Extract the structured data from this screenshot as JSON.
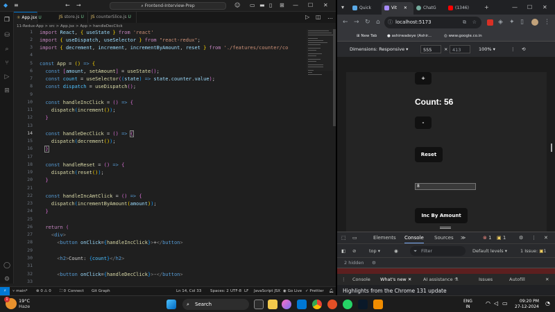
{
  "vscode": {
    "search_text": "Frontend-Interview-Prep",
    "tabs": [
      {
        "name": "App.jsx",
        "mark": "U",
        "active": false
      },
      {
        "name": "store.js",
        "mark": "U",
        "active": false
      },
      {
        "name": "counterSlice.js",
        "mark": "U",
        "active": false
      }
    ],
    "breadcrumb": [
      "11-Redux-App",
      "src",
      "App.jsx",
      "App",
      "handleDecClick"
    ],
    "line_numbers": [
      "1",
      "2",
      "3",
      "4",
      "5",
      "6",
      "7",
      "8",
      "9",
      "10",
      "11",
      "12",
      "13",
      "14",
      "15",
      "16",
      "17",
      "18",
      "19",
      "20",
      "21",
      "22",
      "23",
      "24",
      "25",
      "26",
      "27",
      "28",
      "29",
      "30",
      "31",
      "32",
      "33"
    ],
    "current_line": "14",
    "status": {
      "branch": "main*",
      "errors": "0",
      "warnings": "0",
      "ports": "0",
      "connect": "Connect",
      "git_graph": "Git Graph",
      "position": "Ln 14, Col 33",
      "spaces": "Spaces: 2",
      "encoding": "UTF-8",
      "eol": "LF",
      "language": "JavaScript JSX",
      "golive": "Go Live",
      "prettier": "Prettier"
    }
  },
  "browser": {
    "tabs": [
      {
        "title": "Quick",
        "active": false,
        "color": "#5aa9e6"
      },
      {
        "title": "Vit",
        "active": true,
        "color": "#a78bfa"
      },
      {
        "title": "ChatG",
        "active": false,
        "color": "#74aa9c"
      },
      {
        "title": "(1346)",
        "active": false,
        "color": "#ff0000"
      }
    ],
    "url": "localhost:5173",
    "bookmarks": [
      "New Tab",
      "ashirwadeye (Ashir...",
      "www.google.co.in"
    ],
    "devbar": {
      "dimensions": "Dimensions: Responsive",
      "width": "555",
      "height": "413",
      "zoom": "100%"
    },
    "page": {
      "increment_label": "+",
      "count_text": "Count: 56",
      "decrement_label": "-",
      "reset_label": "Reset",
      "amount_value": "8",
      "inc_amount_label": "Inc By Amount"
    },
    "devtools": {
      "tabs": [
        "Elements",
        "Console",
        "Sources"
      ],
      "active_tab": "Console",
      "error_count": "1",
      "warning_count": "1",
      "context": "top",
      "filter_placeholder": "Filter",
      "levels": "Default levels",
      "issues": "1 Issue:",
      "issue_count": "1",
      "hidden": "2 hidden",
      "drawer_tabs": [
        "Console",
        "What's new",
        "AI assistance",
        "Issues",
        "Autofill"
      ],
      "active_drawer_tab": "What's new",
      "highlights": "Highlights from the Chrome 131 update"
    }
  },
  "taskbar": {
    "weather_temp": "19°C",
    "weather_desc": "Haze",
    "search_text": "Search",
    "lang": "ENG",
    "region": "IN",
    "time": "09:20 PM",
    "date": "27-12-2024",
    "notify_badge": "1"
  }
}
